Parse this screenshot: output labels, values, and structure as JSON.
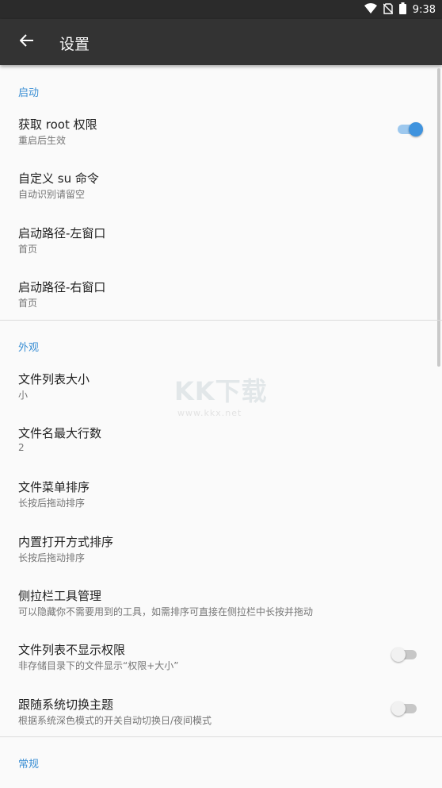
{
  "status_bar": {
    "time": "9:38",
    "icons": [
      "wifi-icon",
      "no-sim-icon",
      "battery-icon"
    ]
  },
  "toolbar": {
    "title": "设置",
    "back_icon": "arrow-back-icon"
  },
  "colors": {
    "accent": "#3b8fd4",
    "toolbar": "#333333",
    "status_bar": "#2b2b2b",
    "background": "#fafafa"
  },
  "sections": [
    {
      "header": "启动",
      "items": [
        {
          "title": "获取 root 权限",
          "subtitle": "重启后生效",
          "switch": "on"
        },
        {
          "title": "自定义 su 命令",
          "subtitle": "自动识别请留空"
        },
        {
          "title": "启动路径-左窗口",
          "subtitle": "首页"
        },
        {
          "title": "启动路径-右窗口",
          "subtitle": "首页"
        }
      ]
    },
    {
      "header": "外观",
      "items": [
        {
          "title": "文件列表大小",
          "subtitle": "小"
        },
        {
          "title": "文件名最大行数",
          "subtitle": "2"
        },
        {
          "title": "文件菜单排序",
          "subtitle": "长按后拖动排序"
        },
        {
          "title": "内置打开方式排序",
          "subtitle": "长按后拖动排序"
        },
        {
          "title": "侧拉栏工具管理",
          "subtitle": "可以隐藏你不需要用到的工具，如需排序可直接在侧拉栏中长按并拖动"
        },
        {
          "title": "文件列表不显示权限",
          "subtitle": "非存储目录下的文件显示“权限+大小”",
          "switch": "off"
        },
        {
          "title": "跟随系统切换主题",
          "subtitle": "根据系统深色模式的开关自动切换日/夜间模式",
          "switch": "off"
        }
      ]
    },
    {
      "header": "常规",
      "items": []
    }
  ],
  "watermark": {
    "logo": "KK下载",
    "url": "www.kkx.net"
  }
}
